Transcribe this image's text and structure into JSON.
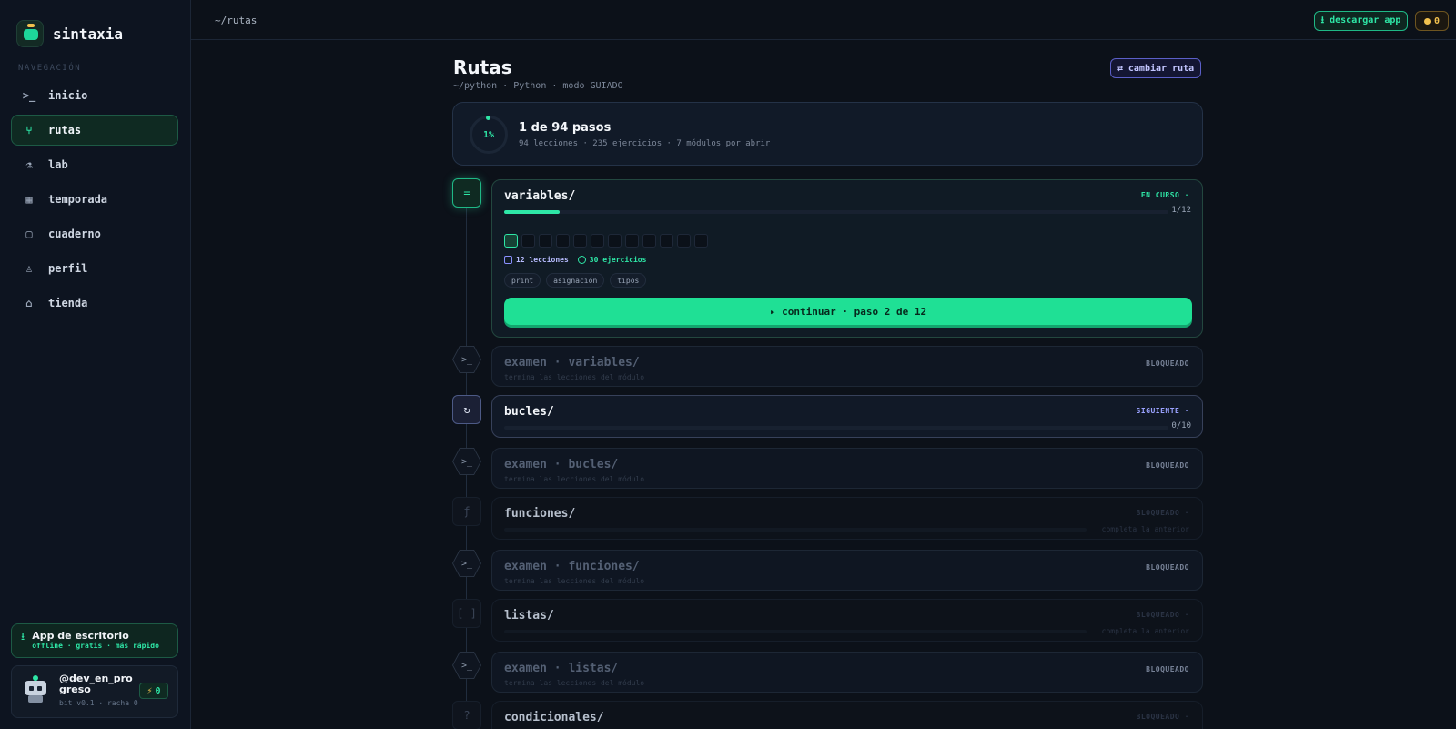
{
  "brand": {
    "name": "sintaxia"
  },
  "sidebar": {
    "nav_title": "NAVEGACIÓN",
    "items": [
      {
        "label": "inicio",
        "icon": "terminal-icon",
        "glyph": ">_"
      },
      {
        "label": "rutas",
        "icon": "route-icon",
        "glyph": "⑂"
      },
      {
        "label": "lab",
        "icon": "flask-icon",
        "glyph": "⚗"
      },
      {
        "label": "temporada",
        "icon": "calendar-icon",
        "glyph": "▦"
      },
      {
        "label": "cuaderno",
        "icon": "book-icon",
        "glyph": "▢"
      },
      {
        "label": "perfil",
        "icon": "user-icon",
        "glyph": "♙"
      },
      {
        "label": "tienda",
        "icon": "store-icon",
        "glyph": "⌂"
      }
    ],
    "active_index": 1,
    "desktop_app": {
      "title": "App de escritorio",
      "subtitle": "offline · gratis · más rápido"
    },
    "user": {
      "handle": "@dev_en_progreso",
      "subtitle": "bit v0.1 · racha 0",
      "streak": "0"
    }
  },
  "topbar": {
    "breadcrumb": "~/rutas",
    "download_label": "⭳ descargar app",
    "coins": "0"
  },
  "page": {
    "title": "Rutas",
    "subtitle": "~/python · Python · modo GUIADO",
    "switch_label": "⇄ cambiar ruta"
  },
  "summary": {
    "percent": "1%",
    "title": "1 de 94 pasos",
    "subtitle": "94 lecciones · 235 ejercicios · 7 módulos por abrir"
  },
  "modules": {
    "variables": {
      "title": "variables/",
      "status": "EN CURSO ·",
      "progress": 0.083,
      "count": "1/12",
      "steps_total": 12,
      "steps_done": 1,
      "lessons": "12 lecciones",
      "exercises": "30 ejercicios",
      "tags": [
        "print",
        "asignación",
        "tipos"
      ],
      "continue_label": "▸ continuar · paso 2 de 12",
      "node": "="
    },
    "exam_variables": {
      "title": "examen · variables/",
      "hint": "termina las lecciones del módulo",
      "status": "BLOQUEADO",
      "node": ">_"
    },
    "bucles": {
      "title": "bucles/",
      "status": "SIGUIENTE ·",
      "progress": 0,
      "count": "0/10",
      "node": "↻"
    },
    "exam_bucles": {
      "title": "examen · bucles/",
      "hint": "termina las lecciones del módulo",
      "status": "BLOQUEADO",
      "node": ">_"
    },
    "funciones": {
      "title": "funciones/",
      "status": "BLOQUEADO ·",
      "hint": "completa la anterior",
      "node": "ƒ"
    },
    "exam_funciones": {
      "title": "examen · funciones/",
      "hint": "termina las lecciones del módulo",
      "status": "BLOQUEADO",
      "node": ">_"
    },
    "listas": {
      "title": "listas/",
      "status": "BLOQUEADO ·",
      "hint": "completa la anterior",
      "node": "[ ]"
    },
    "exam_listas": {
      "title": "examen · listas/",
      "hint": "termina las lecciones del módulo",
      "status": "BLOQUEADO",
      "node": ">_"
    },
    "condicionales": {
      "title": "condicionales/",
      "status": "BLOQUEADO ·",
      "node": "?"
    }
  },
  "colors": {
    "accent": "#2ee6a6",
    "next": "#9aa2ff",
    "coin": "#f2c14e",
    "background": "#0c1119"
  }
}
